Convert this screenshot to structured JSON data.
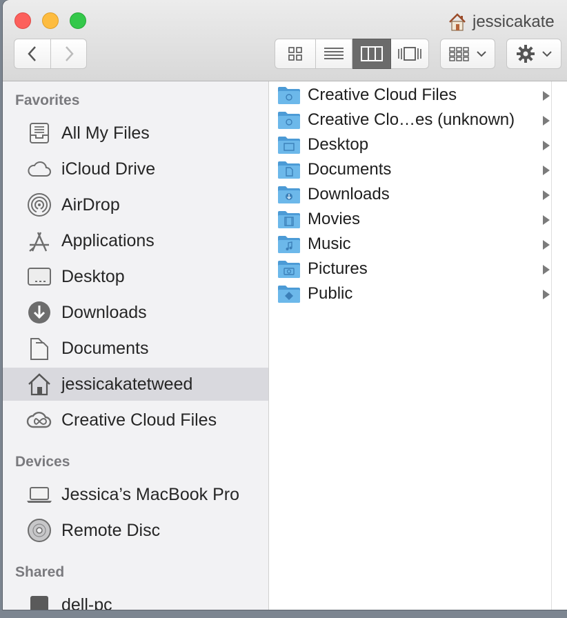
{
  "window": {
    "title": "jessicakate",
    "title_icon": "home-icon"
  },
  "toolbar": {
    "nav": [
      {
        "name": "back",
        "icon": "chevron-left-icon"
      },
      {
        "name": "forward",
        "icon": "chevron-right-icon"
      }
    ],
    "view_modes": [
      "icon-view",
      "list-view",
      "column-view",
      "cover-flow-view"
    ],
    "active_view": "column-view",
    "arrange_icon": "arrange-grid-icon",
    "action_icon": "gear-icon"
  },
  "sidebar": {
    "favorites_header": "Favorites",
    "favorites": [
      {
        "label": "All My Files",
        "icon": "all-files-icon"
      },
      {
        "label": "iCloud Drive",
        "icon": "cloud-icon"
      },
      {
        "label": "AirDrop",
        "icon": "airdrop-icon"
      },
      {
        "label": "Applications",
        "icon": "applications-icon"
      },
      {
        "label": "Desktop",
        "icon": "desktop-icon"
      },
      {
        "label": "Downloads",
        "icon": "download-icon"
      },
      {
        "label": "Documents",
        "icon": "documents-icon"
      },
      {
        "label": "jessicakatetweed",
        "icon": "home-icon",
        "selected": true
      },
      {
        "label": "Creative Cloud Files",
        "icon": "creative-cloud-icon"
      }
    ],
    "devices_header": "Devices",
    "devices": [
      {
        "label": "Jessica’s MacBook Pro",
        "icon": "laptop-icon"
      },
      {
        "label": "Remote Disc",
        "icon": "disc-icon"
      }
    ],
    "shared_header": "Shared",
    "shared": [
      {
        "label": "dell-pc",
        "icon": "pc-icon"
      }
    ]
  },
  "column": {
    "items": [
      {
        "name": "Creative Cloud Files",
        "badge": "cc"
      },
      {
        "name": "Creative Clo…es (unknown)",
        "badge": "cc"
      },
      {
        "name": "Desktop",
        "badge": "desktop"
      },
      {
        "name": "Documents",
        "badge": "doc"
      },
      {
        "name": "Downloads",
        "badge": "download"
      },
      {
        "name": "Movies",
        "badge": "film"
      },
      {
        "name": "Music",
        "badge": "note"
      },
      {
        "name": "Pictures",
        "badge": "camera"
      },
      {
        "name": "Public",
        "badge": "public"
      }
    ]
  },
  "colors": {
    "folder": "#6cb8ea",
    "folder_dark": "#4c9bd6",
    "selection": "#d9d9de",
    "active_segment": "#6b6b6b"
  }
}
